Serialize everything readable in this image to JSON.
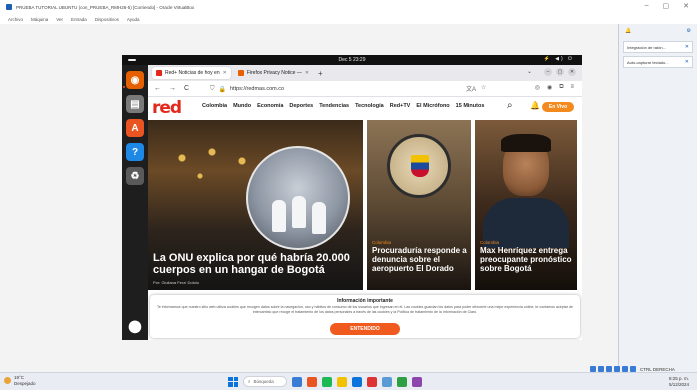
{
  "host": {
    "window_title": "PRUEBA TUTORIAL UBUNTU (con_PRUEBA_RMH26-5) [Corriendo] - Oracle VirtualBox",
    "menu": [
      "Archivo",
      "Máquina",
      "Ver",
      "Entrada",
      "Dispositivos",
      "Ayuda"
    ],
    "window_controls": [
      "–",
      "▢",
      "✕"
    ],
    "side_notifications": [
      {
        "label": "Integración de ratón..."
      },
      {
        "label": "Auto-capturar teclado..."
      }
    ],
    "host_key": "CTRL DERECHA"
  },
  "taskbar": {
    "weather_temp": "19°C",
    "weather_desc": "Despejado",
    "search_label": "Búsqueda",
    "time": "8:25 p. m.",
    "date": "5/12/2024",
    "app_colors": [
      "#3a7bd5",
      "#e95420",
      "#1db954",
      "#f2c200",
      "#0a74da",
      "#d33",
      "#5b9bd5",
      "#2ea043",
      "#8e44ad"
    ]
  },
  "vm": {
    "clock": "Dec 5  23:29",
    "system_icons": "⚡ ◀) ⏻",
    "dock": [
      {
        "icon": "firefox-icon",
        "glyph": "◉",
        "color": "#e66000"
      },
      {
        "icon": "files-icon",
        "glyph": "▤",
        "color": "#7a7a7a"
      },
      {
        "icon": "software-icon",
        "glyph": "A",
        "color": "#e95420"
      },
      {
        "icon": "help-icon",
        "glyph": "?",
        "color": "#1e88e5"
      },
      {
        "icon": "trash-icon",
        "glyph": "♻",
        "color": "#5a5a5a"
      }
    ],
    "apps_icon": "⬤"
  },
  "firefox": {
    "tabs": [
      {
        "label": "Red+ Noticias de hoy en",
        "active": true,
        "favicon_color": "#e4271b"
      },
      {
        "label": "Firefox Privacy Notice —",
        "active": false,
        "favicon_color": "#e66000"
      }
    ],
    "new_tab": "+",
    "url": "https://redmas.com.co",
    "nav": {
      "back": "←",
      "forward": "→",
      "reload": "C"
    }
  },
  "site": {
    "logo": "red",
    "nav_items": [
      "Colombia",
      "Mundo",
      "Economía",
      "Deportes",
      "Tendencias",
      "Tecnología",
      "Red+TV",
      "El Micrófono",
      "15 Minutos"
    ],
    "live_button": "En Vivo",
    "cards": [
      {
        "category": "",
        "headline": "La ONU explica por qué habría 20.000 cuerpos en un hangar de Bogotá",
        "byline": "Por: Giuliana Ferzí Dotolo"
      },
      {
        "category": "Colombia",
        "headline": "Procuraduría responde a denuncia sobre el aeropuerto El Dorado"
      },
      {
        "category": "Colombia",
        "headline": "Max Henríquez entrega preocupante pronóstico sobre Bogotá"
      }
    ],
    "cookie": {
      "title": "Información importante",
      "text": "Te informamos que nuestro sitio web utiliza cookies que recogen datos sobre la navegación, uso y hábitos de consumo de los usuarios que ingresan en él. Las cookies guardan los datos para poder ofrecerte una mejor experiencia online, te contamos aceptar de intercambio que recoge el tratamiento de los datos personales a través de las cookies y la Política de tratamiento de la Información de Claro.",
      "button": "ENTENDIDO"
    }
  }
}
